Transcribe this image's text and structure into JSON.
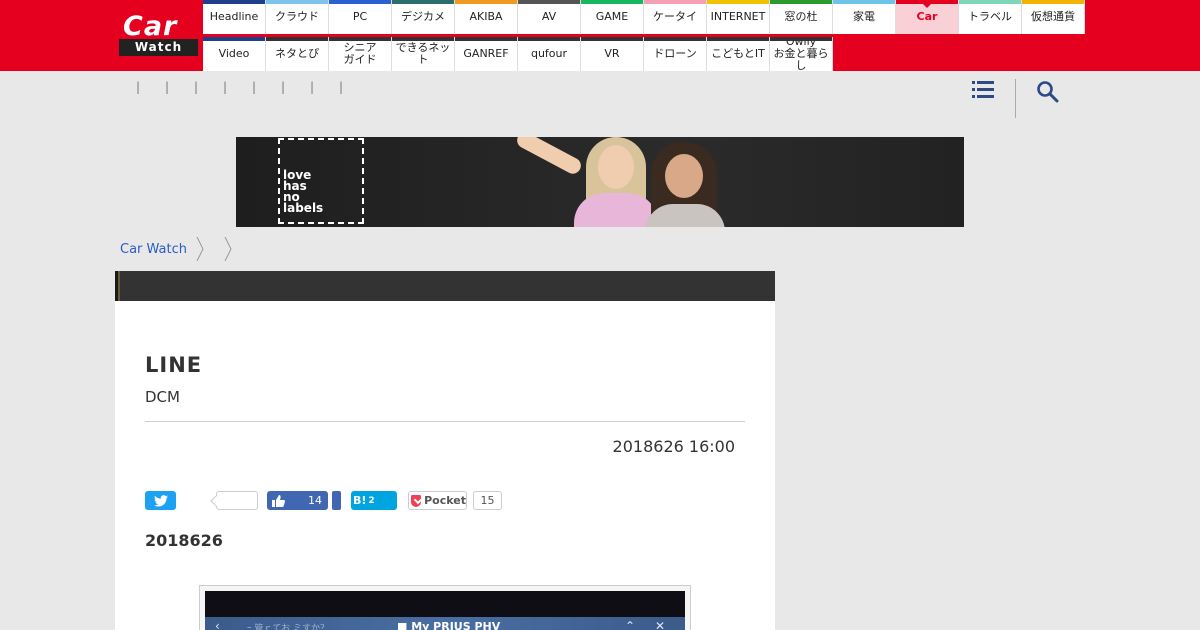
{
  "logo": {
    "line1": "Car",
    "line2": "Watch"
  },
  "nav": {
    "row1": [
      {
        "label": "Headline",
        "color": "#1e3f8c"
      },
      {
        "label": "クラウド",
        "color": "#7ec3e8"
      },
      {
        "label": "PC",
        "color": "#2a5fd0"
      },
      {
        "label": "デジカメ",
        "color": "#2a6e6e"
      },
      {
        "label": "AKIBA",
        "color": "#f09a20"
      },
      {
        "label": "AV",
        "color": "#555555"
      },
      {
        "label": "GAME",
        "color": "#18b860"
      },
      {
        "label": "ケータイ",
        "color": "#f5a0b4"
      },
      {
        "label": "INTERNET",
        "color": "#f2c200"
      },
      {
        "label": "窓の杜",
        "color": "#2c9a2c"
      },
      {
        "label": "家電",
        "color": "#6ec3e8"
      },
      {
        "label": "Car",
        "color": "#e60020",
        "active": true
      },
      {
        "label": "トラベル",
        "color": "#7fd6b8"
      },
      {
        "label": "仮想通貨",
        "color": "#f2b400"
      }
    ],
    "row2": [
      {
        "label": "Video",
        "color": "#1e3f8c"
      },
      {
        "label": "ネタとぴ",
        "color": "#333333"
      },
      {
        "label": "シニア\nガイド",
        "color": "#333333"
      },
      {
        "label": "できるネット",
        "color": "#333333"
      },
      {
        "label": "GANREF",
        "color": "#333333"
      },
      {
        "label": "qufour",
        "color": "#333333"
      },
      {
        "label": "VR",
        "color": "#333333"
      },
      {
        "label": "ドローン",
        "color": "#333333"
      },
      {
        "label": "こどもとIT",
        "color": "#333333"
      },
      {
        "label": "Owlly\nお金と暮らし",
        "color": "#333333"
      }
    ]
  },
  "subnav": {
    "pipes": [
      "|",
      "|",
      "|",
      "|",
      "|",
      "|",
      "|",
      "|"
    ]
  },
  "ad": {
    "text": "love\nhas\nno\nlabels"
  },
  "breadcrumb": {
    "home": "Car Watch"
  },
  "article": {
    "title": "LINE",
    "subtitle": "DCM",
    "date": "2018626 16:00",
    "lead": "2018626"
  },
  "share": {
    "facebook_count": "14",
    "hatena_label": "B!",
    "hatena_count": "2",
    "pocket_label": "Pocket",
    "pocket_count": "15"
  },
  "figure": {
    "strip_left": "ｰ 管ｒてお ミすか？",
    "strip_title": "■ My PRIUS PHV"
  }
}
